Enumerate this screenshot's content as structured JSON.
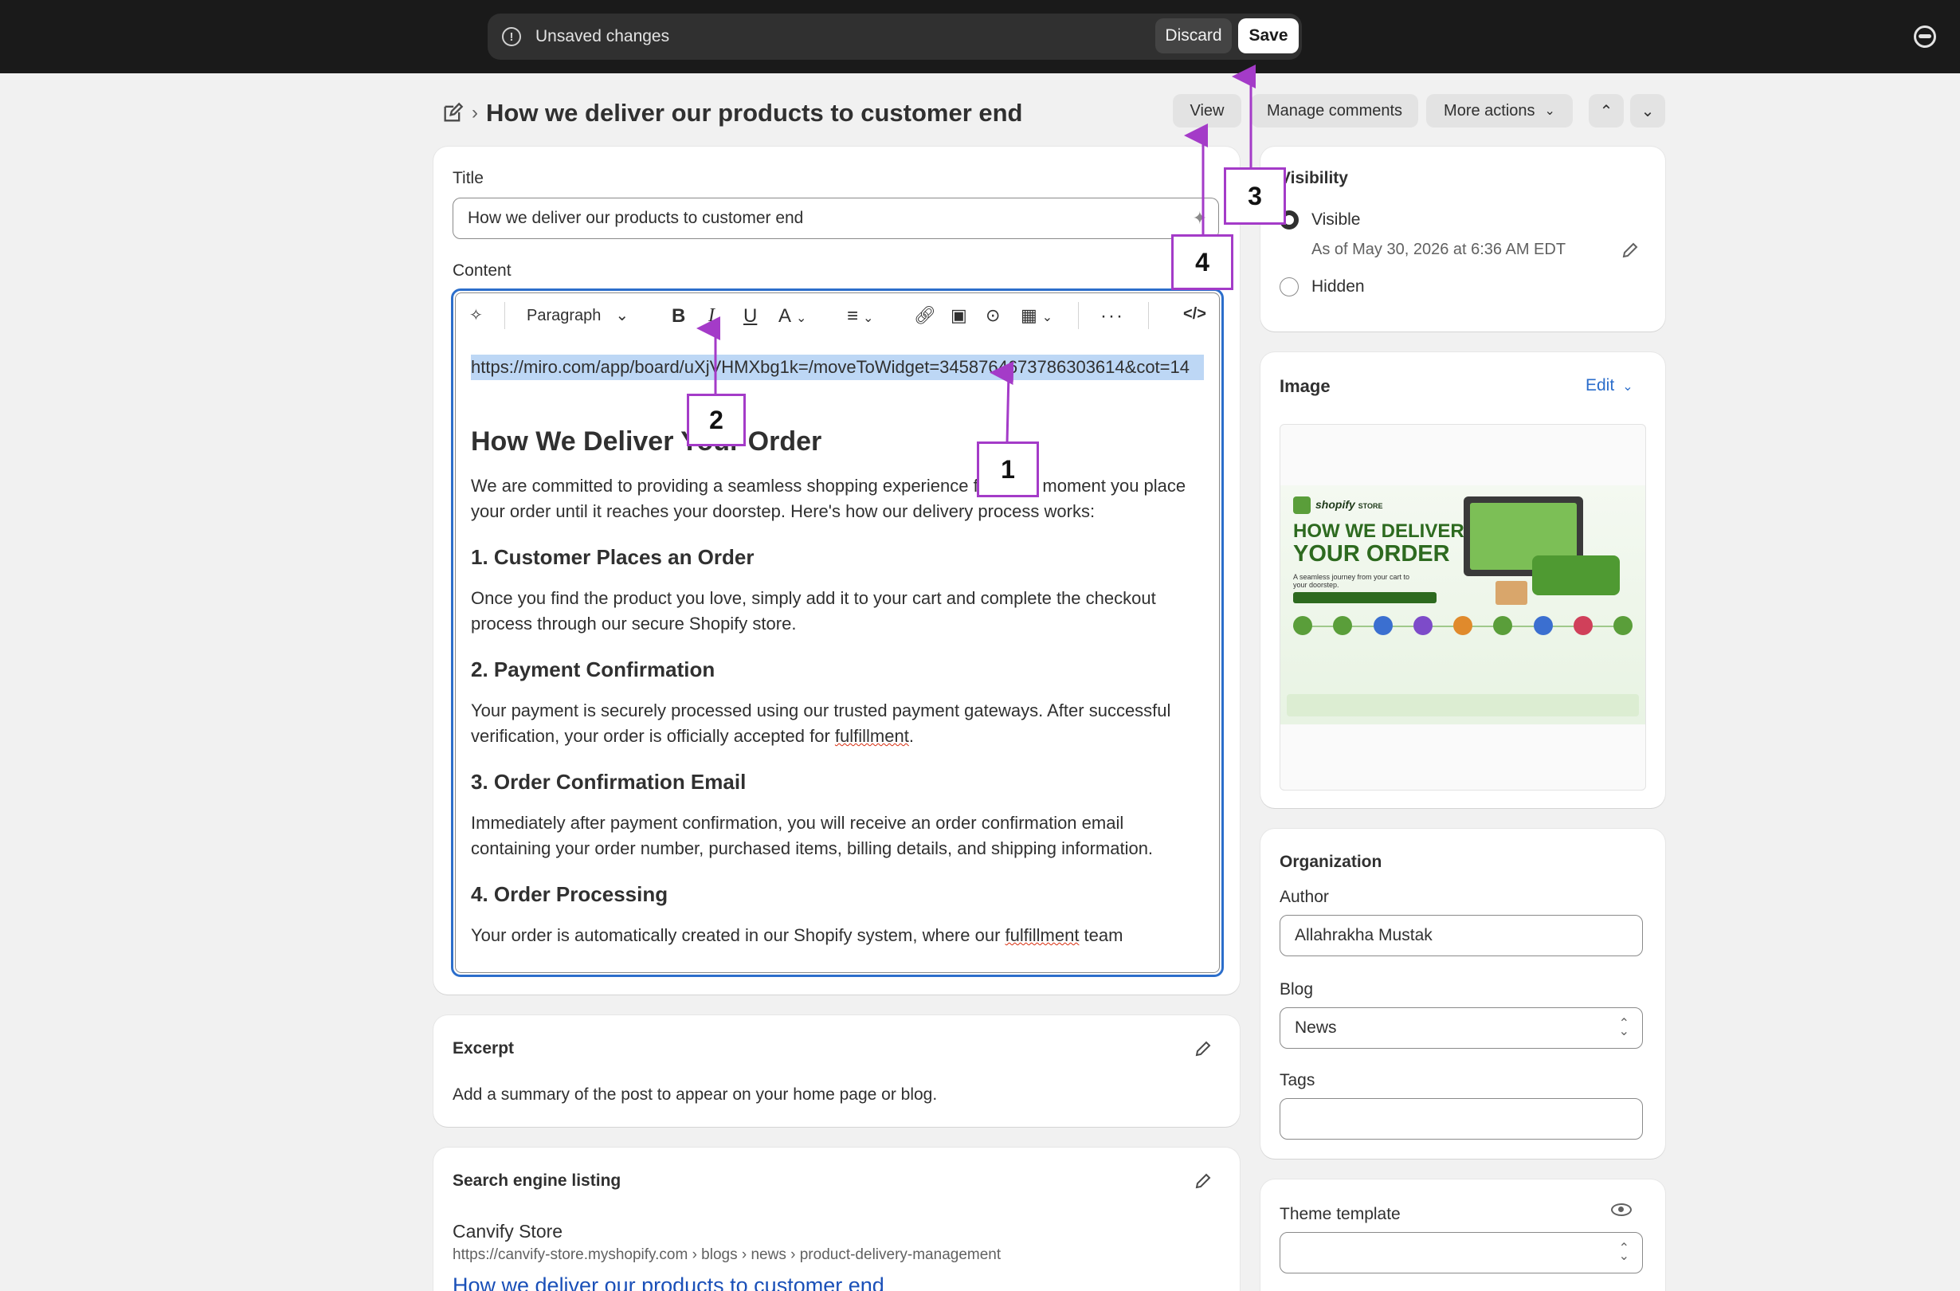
{
  "topbar": {
    "unsaved_text": "Unsaved changes",
    "discard_label": "Discard",
    "save_label": "Save"
  },
  "header": {
    "page_title": "How we deliver our products to customer end",
    "view_label": "View",
    "manage_comments_label": "Manage comments",
    "more_actions_label": "More actions"
  },
  "title_card": {
    "title_label": "Title",
    "title_value": "How we deliver our products to customer end",
    "content_label": "Content"
  },
  "editor": {
    "paragraph_label": "Paragraph",
    "selected_url": "https://miro.com/app/board/uXjVHMXbg1k=/moveToWidget=3458764673786303614&cot=14",
    "heading": "How We Deliver Your Order",
    "intro": "We are committed to providing a seamless shopping experience from the moment you place your order until it reaches your doorstep. Here's how our delivery process works:",
    "s1_title": "1. Customer Places an Order",
    "s1_text": "Once you find the product you love, simply add it to your cart and complete the checkout process through our secure Shopify store.",
    "s2_title": "2. Payment Confirmation",
    "s2_text_a": "Your payment is securely processed using our trusted payment gateways. After successful verification, your order is officially accepted for ",
    "s2_text_b": "fulfillment",
    "s2_text_c": ".",
    "s3_title": "3. Order Confirmation Email",
    "s3_text": "Immediately after payment confirmation, you will receive an order confirmation email containing your order number, purchased items, billing details, and shipping information.",
    "s4_title": "4. Order Processing",
    "s4_text_a": "Your order is automatically created in our Shopify system, where our ",
    "s4_text_b": "fulfillment",
    "s4_text_c": " team"
  },
  "annotations": [
    "1",
    "2",
    "3",
    "4"
  ],
  "excerpt": {
    "title": "Excerpt",
    "text": "Add a summary of the post to appear on your home page or blog."
  },
  "seo": {
    "title": "Search engine listing",
    "store_name": "Canvify Store",
    "url": "https://canvify-store.myshopify.com › blogs › news › product-delivery-management",
    "link": "How we deliver our products to customer end"
  },
  "visibility": {
    "title": "Visibility",
    "visible_label": "Visible",
    "visible_date": "As of May 30, 2026 at 6:36 AM EDT",
    "hidden_label": "Hidden"
  },
  "image": {
    "title": "Image",
    "edit_label": "Edit",
    "thumb_brand": "shopify",
    "thumb_brand_sub": "STORE",
    "thumb_heading_1": "HOW WE DELIVER",
    "thumb_heading_2": "YOUR ORDER",
    "thumb_sub": "A seamless journey from your cart to your doorstep."
  },
  "organization": {
    "title": "Organization",
    "author_label": "Author",
    "author_value": "Allahrakha Mustak",
    "blog_label": "Blog",
    "blog_value": "News",
    "tags_label": "Tags",
    "tags_value": ""
  },
  "theme": {
    "title": "Theme template",
    "value": ""
  },
  "colors": {
    "accent": "#2c6ecb",
    "annotation": "#a43bc8",
    "topbar": "#1a1a1a",
    "selection": "#bdd7f5"
  }
}
